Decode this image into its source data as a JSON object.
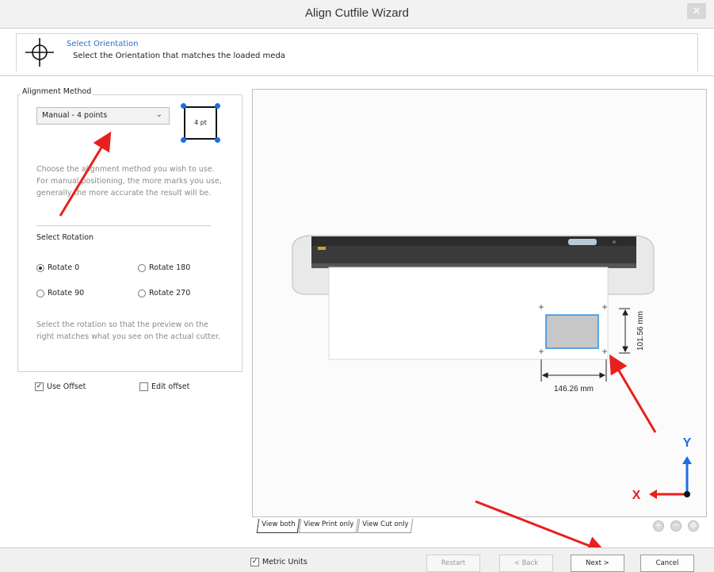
{
  "window": {
    "title": "Align Cutfile Wizard",
    "close_glyph": "✕"
  },
  "header": {
    "title": "Select Orientation",
    "subtitle": "Select the Orientation that matches the loaded meda"
  },
  "alignment": {
    "legend": "Alignment Method",
    "selected_method": "Manual - 4 points",
    "points_label": "4 pt",
    "description": "Choose the alignment method you wish to use. For manual positioning, the more marks you use, generally the more accurate the result will be."
  },
  "rotation": {
    "title": "Select Rotation",
    "options": [
      {
        "label": "Rotate 0",
        "selected": true
      },
      {
        "label": "Rotate 180",
        "selected": false
      },
      {
        "label": "Rotate 90",
        "selected": false
      },
      {
        "label": "Rotate 270",
        "selected": false
      }
    ],
    "description": "Select the rotation so that the preview on the right matches what you see on the actual cutter."
  },
  "offset": {
    "use_offset": {
      "label": "Use Offset",
      "checked": true
    },
    "edit_offset": {
      "label": "Edit offset",
      "checked": false
    }
  },
  "preview": {
    "width_dim": "146.26 mm",
    "height_dim": "101.56 mm",
    "axis_x": "X",
    "axis_y": "Y",
    "tabs": [
      "View both",
      "View Print only",
      "View Cut only"
    ],
    "active_tab": "View both"
  },
  "footer": {
    "metric_units": {
      "label": "Metric Units",
      "checked": true
    },
    "restart": "Restart",
    "back": "< Back",
    "next": "Next >",
    "cancel": "Cancel"
  },
  "colors": {
    "accent_blue": "#1e6fe0",
    "arrow_red": "#e8201c"
  }
}
